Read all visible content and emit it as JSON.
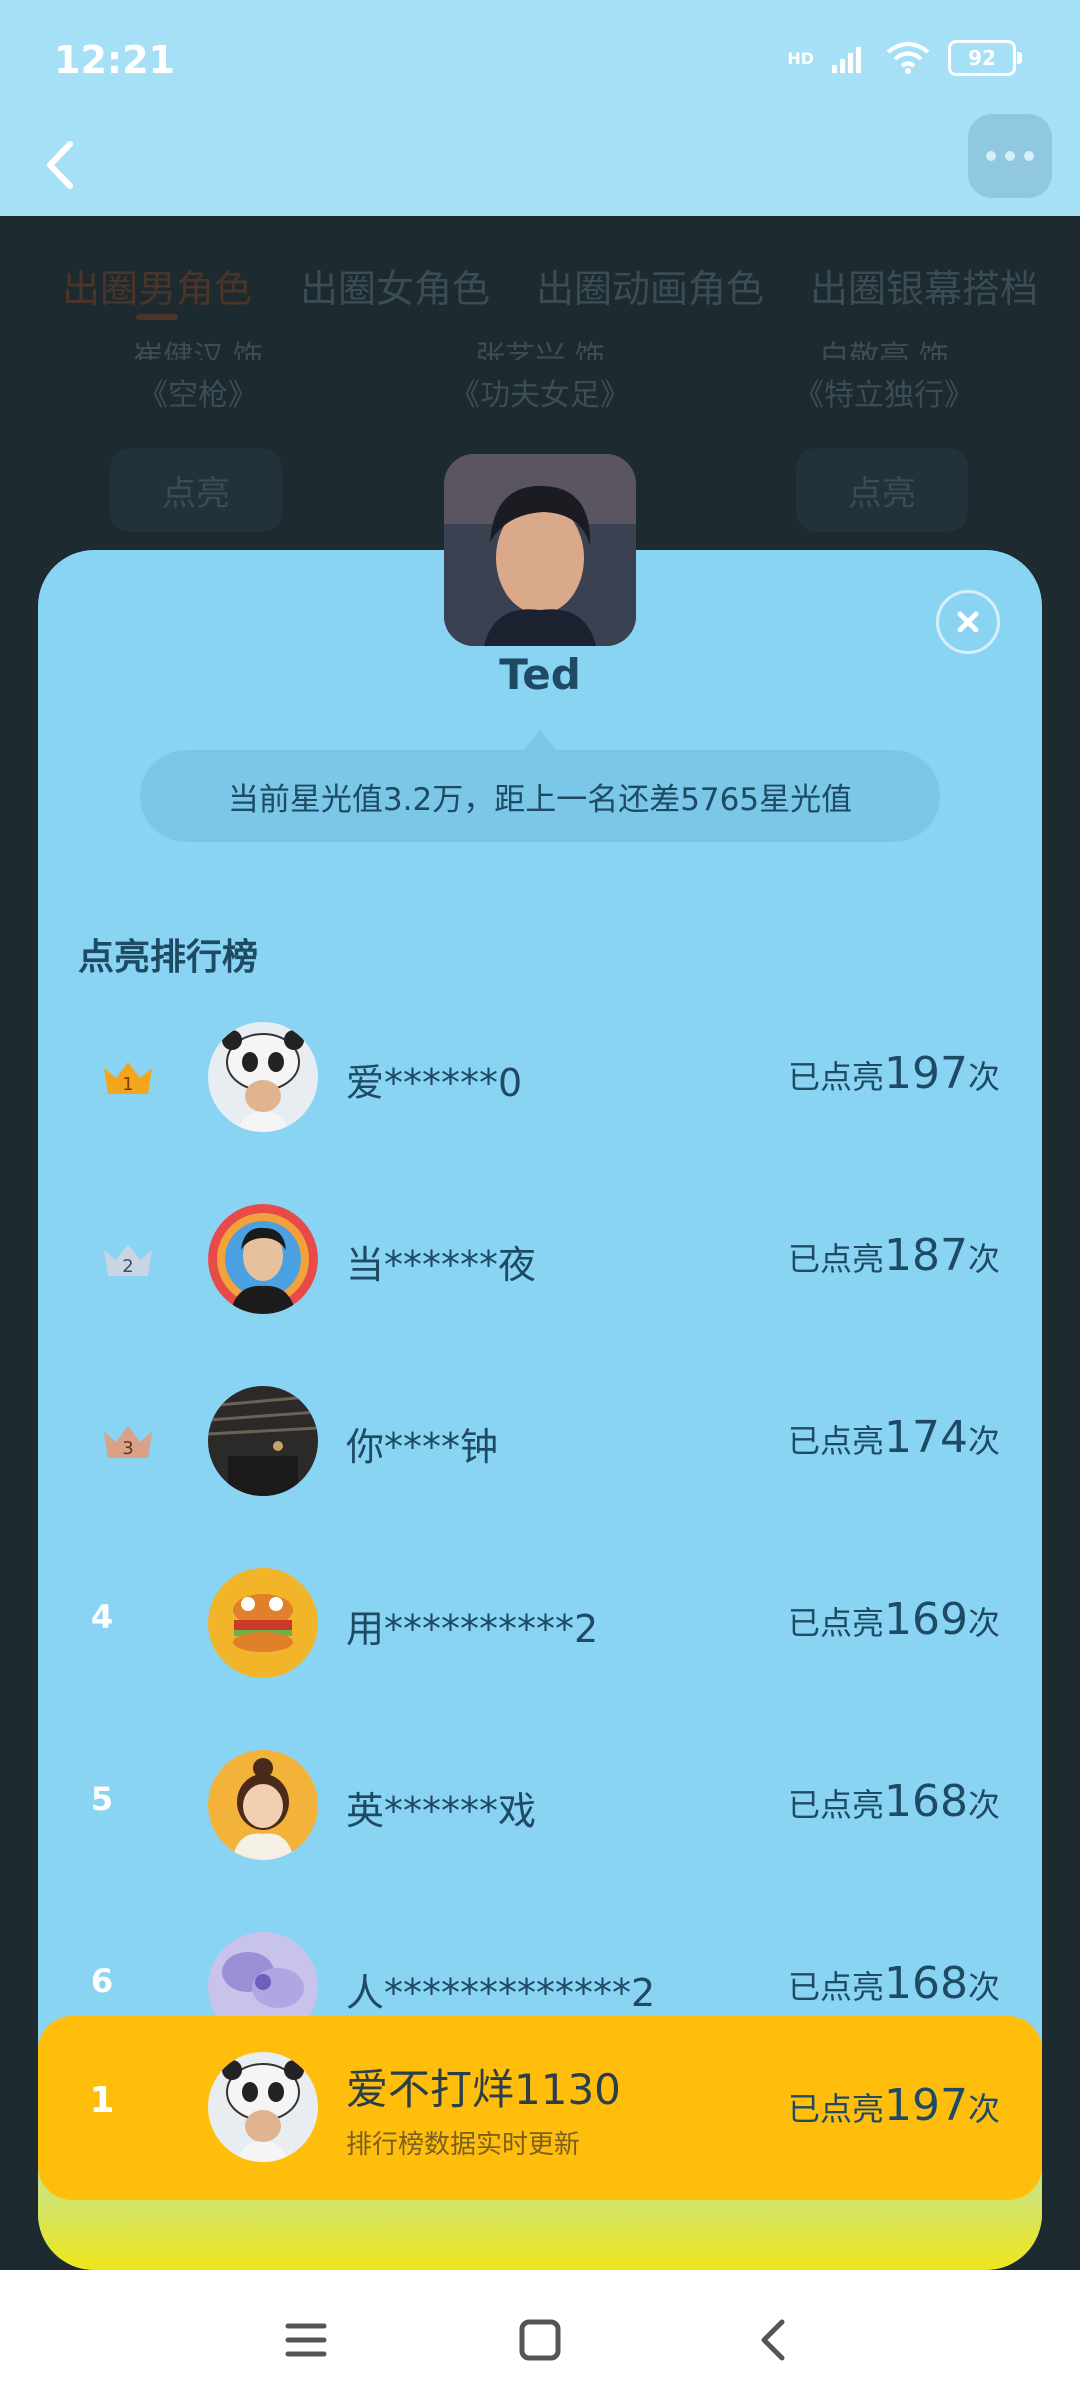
{
  "status_bar": {
    "time": "12:21",
    "network": "HD",
    "battery": "92"
  },
  "background": {
    "tabs": [
      "出圈男角色",
      "出圈女角色",
      "出圈动画角色",
      "出圈银幕搭档"
    ],
    "cards": [
      {
        "top_text": "崔健汉 饰",
        "title": "《空枪》",
        "button": "点亮"
      },
      {
        "top_text": "张艺兴 饰",
        "title": "《功夫女足》",
        "button": ""
      },
      {
        "top_text": "白敬亭 饰",
        "title": "《特立独行》",
        "button": "点亮"
      }
    ]
  },
  "modal": {
    "star_name": "Ted",
    "info_text": "当前星光值3.2万，距上一名还差5765星光值",
    "section_title": "点亮排行榜",
    "count_prefix": "已点亮",
    "count_suffix": "次",
    "rows": [
      {
        "rank": "1",
        "name": "爱******0",
        "count": "197",
        "avatar": "panda-avatar"
      },
      {
        "rank": "2",
        "name": "当******夜",
        "count": "187",
        "avatar": "man-rainbow-avatar"
      },
      {
        "rank": "3",
        "name": "你****钟",
        "count": "174",
        "avatar": "dark-hall-avatar"
      },
      {
        "rank": "4",
        "name": "用**********2",
        "count": "169",
        "avatar": "burger-avatar"
      },
      {
        "rank": "5",
        "name": "英******戏",
        "count": "168",
        "avatar": "girl-cartoon-avatar"
      },
      {
        "rank": "6",
        "name": "人*************2",
        "count": "168",
        "avatar": "purple-flower-avatar"
      }
    ]
  },
  "my_rank": {
    "rank": "1",
    "name": "爱不打烊1130",
    "subtitle": "排行榜数据实时更新",
    "count": "197"
  },
  "colors": {
    "accent_yellow": "#ffbe0b",
    "modal_bg": "#8ad4f3",
    "text": "#1e4a63"
  }
}
